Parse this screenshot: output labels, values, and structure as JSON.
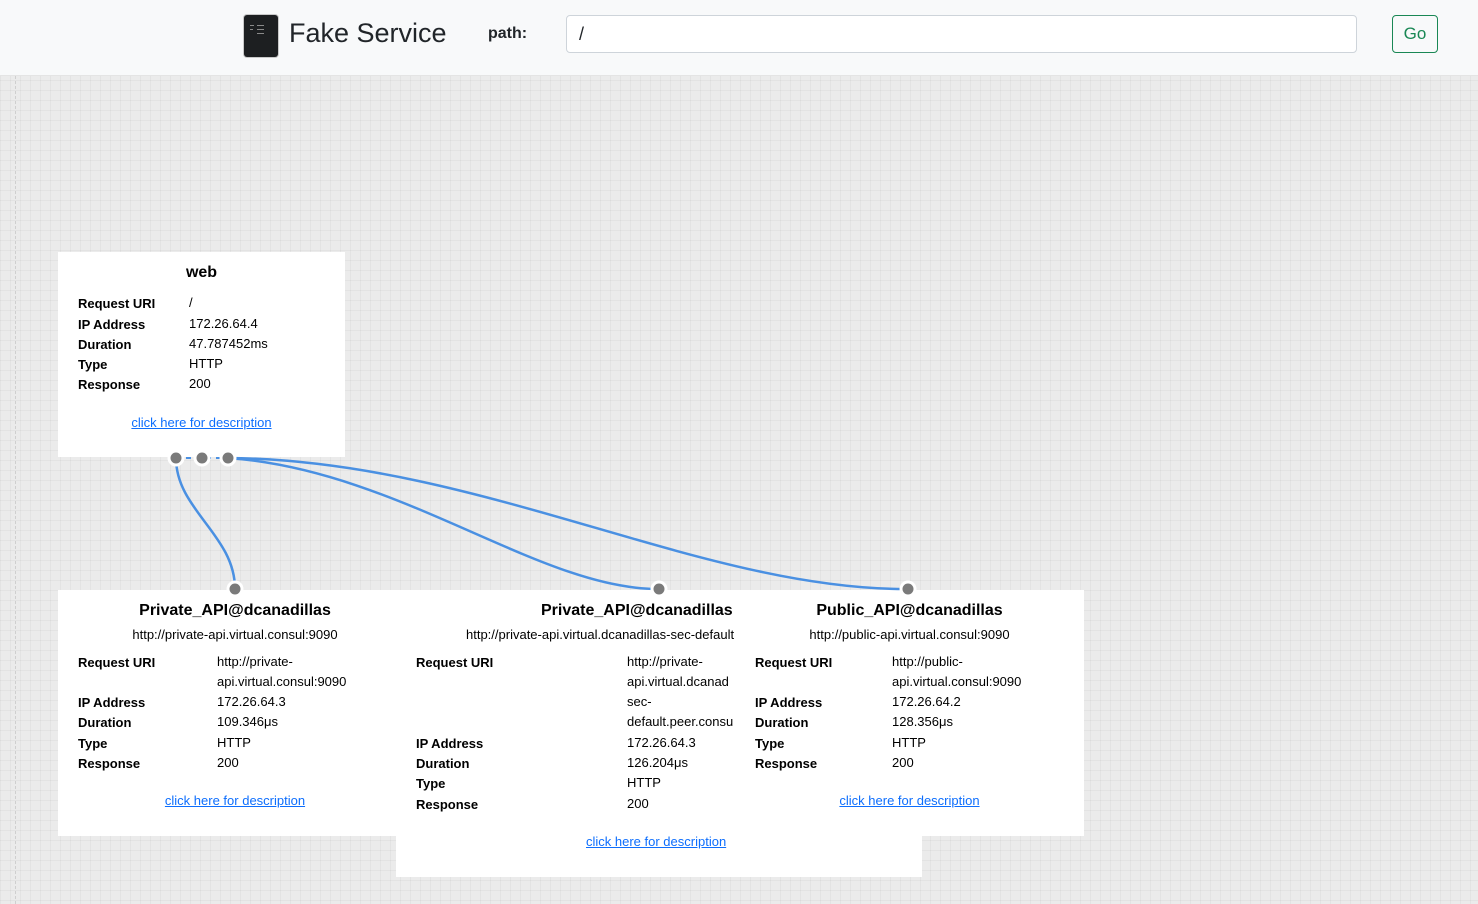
{
  "header": {
    "brand": "Fake Service",
    "path_label": "path:",
    "path_value": "/",
    "go_label": "Go",
    "brand_icon": "terminal-logo-icon"
  },
  "colors": {
    "accent_green": "#198754",
    "link_blue": "#0d6efd",
    "wire_blue": "#4a90e2",
    "port_gray": "#7a7a7a"
  },
  "labels": {
    "request_uri": "Request URI",
    "ip_address": "IP Address",
    "duration": "Duration",
    "type": "Type",
    "response": "Response",
    "description_link": "click here for description"
  },
  "nodes": {
    "web": {
      "name": "web",
      "request_uri": "/",
      "ip_address": "172.26.64.4",
      "duration": "47.787452ms",
      "type": "HTTP",
      "response": "200"
    },
    "private_api_1": {
      "name": "Private_API@dcanadillas",
      "url": "http://private-api.virtual.consul:9090",
      "request_uri_l1": "http://private-",
      "request_uri_l2": "api.virtual.consul:9090",
      "ip_address": "172.26.64.3",
      "duration": "109.346μs",
      "type": "HTTP",
      "response": "200"
    },
    "private_api_2": {
      "name": "Private_API@dcanadillas",
      "url": "http://private-api.virtual.dcanadillas-sec-default",
      "request_uri_l1": "http://private-",
      "request_uri_l2": "api.virtual.dcanad",
      "request_uri_l3": "sec-",
      "request_uri_l4": "default.peer.consu",
      "ip_address": "172.26.64.3",
      "duration": "126.204μs",
      "type": "HTTP",
      "response": "200"
    },
    "public_api": {
      "name": "Public_API@dcanadillas",
      "url": "http://public-api.virtual.consul:9090",
      "request_uri_l1": "http://public-",
      "request_uri_l2": "api.virtual.consul:9090",
      "ip_address": "172.26.64.2",
      "duration": "128.356μs",
      "type": "HTTP",
      "response": "200"
    }
  }
}
